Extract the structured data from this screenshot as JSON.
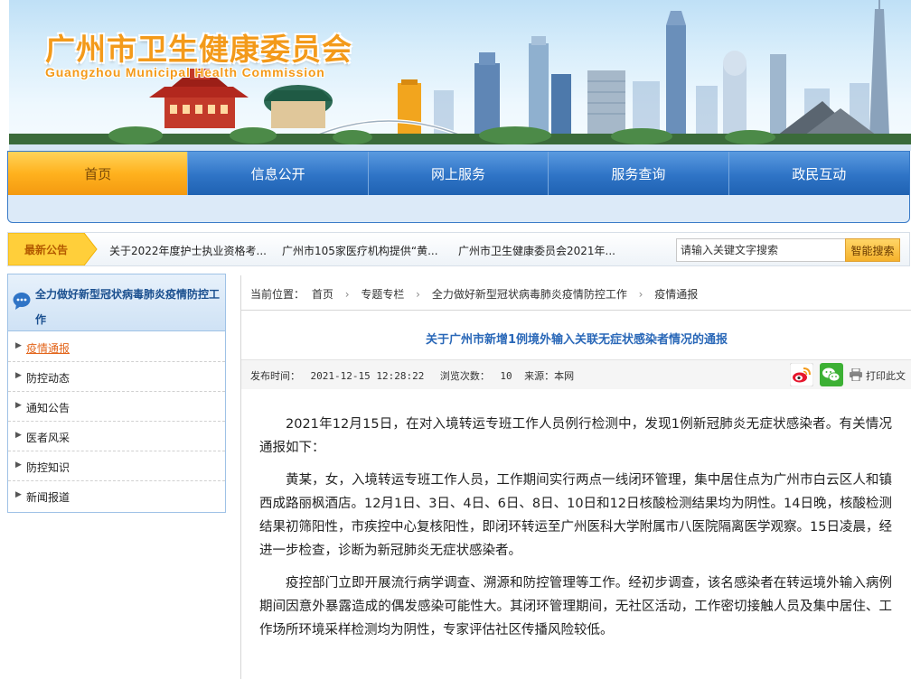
{
  "site": {
    "title_cn": "广州市卫生健康委员会",
    "title_en": "Guangzhou Municipal Health Commission"
  },
  "nav": {
    "items": [
      "首页",
      "信息公开",
      "网上服务",
      "服务查询",
      "政民互动"
    ],
    "active_index": 0
  },
  "notice": {
    "label": "最新公告",
    "links": [
      "关于2022年度护士执业资格考...",
      "广州市105家医疗机构提供“黄...",
      "广州市卫生健康委员会2021年..."
    ]
  },
  "search": {
    "placeholder": "请输入关键文字搜索",
    "button_label": "智能搜索"
  },
  "sidebar": {
    "title": "全力做好新型冠状病毒肺炎疫情防控工作",
    "items": [
      "疫情通报",
      "防控动态",
      "通知公告",
      "医者风采",
      "防控知识",
      "新闻报道"
    ],
    "active_index": 0
  },
  "breadcrumb": {
    "label": "当前位置：",
    "items": [
      "首页",
      "专题专栏",
      "全力做好新型冠状病毒肺炎疫情防控工作",
      "疫情通报"
    ]
  },
  "article": {
    "title": "关于广州市新增1例境外输入关联无症状感染者情况的通报",
    "meta": {
      "publish_label": "发布时间：",
      "publish_time": "2021-12-15 12:28:22",
      "views_label": "浏览次数：",
      "views": "10",
      "source_label": "来源：",
      "source": "本网",
      "print_label": "打印此文"
    },
    "paragraphs": [
      "2021年12月15日，在对入境转运专班工作人员例行检测中，发现1例新冠肺炎无症状感染者。有关情况通报如下：",
      "黄某，女，入境转运专班工作人员，工作期间实行两点一线闭环管理，集中居住点为广州市白云区人和镇西成路丽枫酒店。12月1日、3日、4日、6日、8日、10日和12日核酸检测结果均为阴性。14日晚，核酸检测结果初筛阳性，市疾控中心复核阳性，即闭环转运至广州医科大学附属市八医院隔离医学观察。15日凌晨，经进一步检查，诊断为新冠肺炎无症状感染者。",
      "疫控部门立即开展流行病学调查、溯源和防控管理等工作。经初步调查，该名感染者在转运境外输入病例期间因意外暴露造成的偶发感染可能性大。其闭环管理期间，无社区活动，工作密切接触人员及集中居住、工作场所环境采样检测均为阴性，专家评估社区传播风险较低。"
    ]
  },
  "colors": {
    "accent_blue": "#2f74c6",
    "accent_orange": "#f39a1a",
    "title_blue": "#2a68b8",
    "active_link": "#e3661c"
  }
}
